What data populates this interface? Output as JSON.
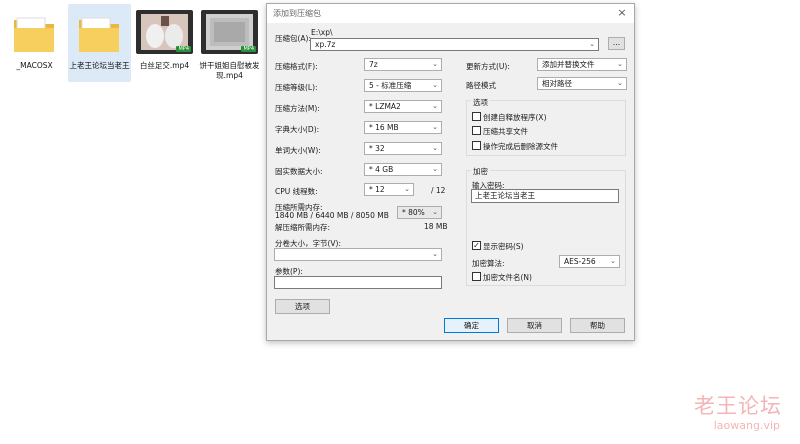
{
  "desktop": {
    "items": [
      {
        "label": "_MACOSX",
        "type": "folder"
      },
      {
        "label": "上老王论坛当老王",
        "type": "folder"
      },
      {
        "label": "白丝足交.mp4",
        "type": "video",
        "badge": "MP4"
      },
      {
        "label": "饼干姐姐自慰被发现.mp4",
        "type": "video",
        "badge": "MP4"
      }
    ]
  },
  "dialog": {
    "title": "添加到压缩包",
    "archive_label": "压缩包(A):",
    "archive_path": "E:\\xp\\",
    "archive_name": "xp.7z",
    "browse_label": "...",
    "format_label": "压缩格式(F):",
    "format_value": "7z",
    "level_label": "压缩等级(L):",
    "level_value": "5 - 标准压缩",
    "method_label": "压缩方法(M):",
    "method_value": "* LZMA2",
    "dict_label": "字典大小(D):",
    "dict_value": "* 16 MB",
    "word_label": "单词大小(W):",
    "word_value": "* 32",
    "solid_label": "固实数据大小:",
    "solid_value": "* 4 GB",
    "cpu_label": "CPU 线程数:",
    "cpu_value": "* 12",
    "cpu_max": "/ 12",
    "mem_label": "压缩所需内存:",
    "mem_detail": "1840 MB / 6440 MB / 8050 MB",
    "mem_value": "* 80%",
    "decomp_label": "解压缩所需内存:",
    "decomp_value": "18 MB",
    "split_label": "分卷大小，字节(V):",
    "split_value": "",
    "params_label": "参数(P):",
    "params_value": "",
    "options_button": "选项",
    "update_label": "更新方式(U):",
    "update_value": "添加并替换文件",
    "path_label": "路径模式",
    "path_value": "相对路径",
    "options_group": "选项",
    "opt_sfx": "创建自释放程序(X)",
    "opt_shared": "压缩共享文件",
    "opt_delete": "操作完成后删除源文件",
    "encrypt_group": "加密",
    "password_label": "输入密码:",
    "password_value": "上老王论坛当老王",
    "show_password": "显示密码(S)",
    "enc_method_label": "加密算法:",
    "enc_method_value": "AES-256",
    "encrypt_names": "加密文件名(N)",
    "ok": "确定",
    "cancel": "取消",
    "help": "帮助",
    "close": "×"
  },
  "watermark": {
    "line1": "老王论坛",
    "line2": "laowang.vip"
  },
  "colors": {
    "selection": "#dce9f7",
    "dialog_bg": "#f0f0f0",
    "watermark": "#f3b5b5",
    "folder": "#f6cf5e"
  }
}
